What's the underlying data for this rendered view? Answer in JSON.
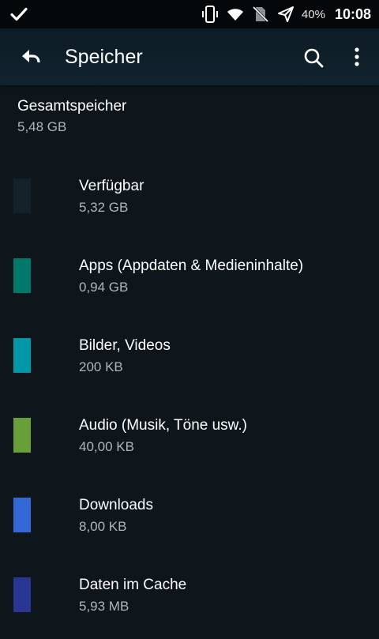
{
  "status_bar": {
    "battery": "40%",
    "time": "10:08",
    "icons": [
      "check-icon",
      "vibrate-icon",
      "wifi-icon",
      "no-sim-icon",
      "airplane-mode-icon"
    ]
  },
  "app_bar": {
    "title": "Speicher",
    "icons": [
      "back-arrow-icon",
      "search-icon",
      "overflow-menu-icon"
    ]
  },
  "total": {
    "label": "Gesamtspeicher",
    "value": "5,48 GB"
  },
  "categories": [
    {
      "label": "Verfügbar",
      "value": "5,32 GB",
      "color": "#13212b"
    },
    {
      "label": "Apps (Appdaten & Medieninhalte)",
      "value": "0,94 GB",
      "color": "#00796b"
    },
    {
      "label": "Bilder, Videos",
      "value": "200 KB",
      "color": "#0097a7"
    },
    {
      "label": "Audio (Musik, Töne usw.)",
      "value": "40,00 KB",
      "color": "#689f38"
    },
    {
      "label": "Downloads",
      "value": "8,00 KB",
      "color": "#3367d6"
    },
    {
      "label": "Daten im Cache",
      "value": "5,93 MB",
      "color": "#283593"
    }
  ]
}
